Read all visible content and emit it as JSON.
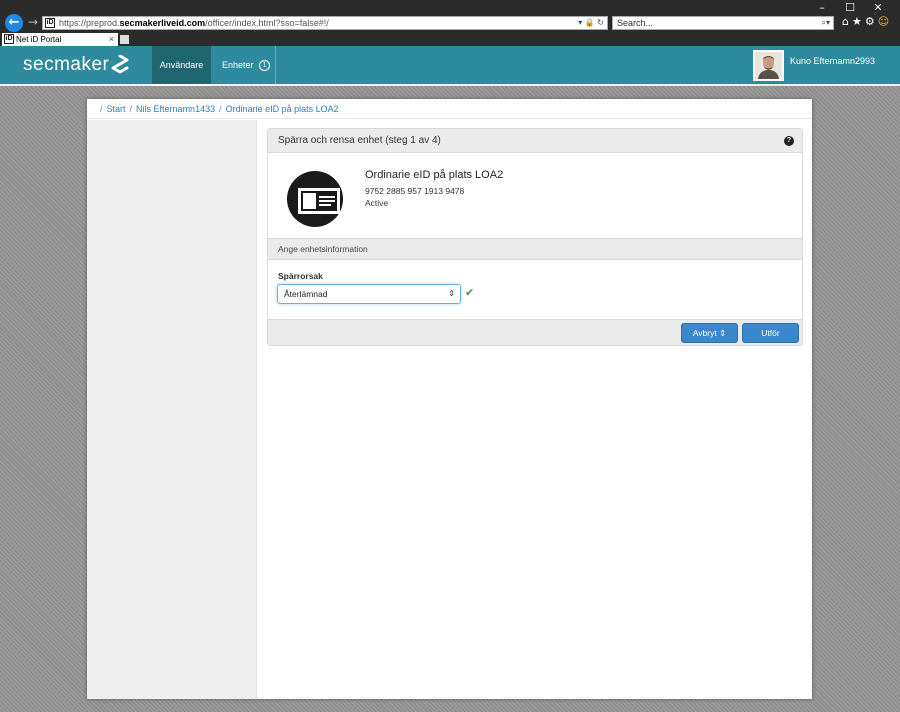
{
  "browser": {
    "url_prefix": "https://preprod.",
    "url_domain": "secmakerliveid.com",
    "url_path": "/officer/index.html?sso=false#!/",
    "address_icons": "▾ 🔒 ↻",
    "search_placeholder": "Search...",
    "search_icon": "⌕▾",
    "tab_title": "Net iD Portal",
    "tab_close": "×",
    "favicon_text": "iD",
    "window_controls": [
      "–",
      "☐",
      "✕"
    ]
  },
  "app": {
    "logo_text": "secmaker",
    "nav": {
      "users_label": "Användare",
      "units_label": "Enheter",
      "units_badge": "1"
    },
    "user_name": "Kuno Efternamn2993"
  },
  "breadcrumb": {
    "items": [
      "Start",
      "Nils Efternamn1433",
      "Ordinarie eID på plats LOA2"
    ]
  },
  "card": {
    "title": "Spärra och rensa enhet (steg 1 av 4)",
    "help_icon": "?",
    "device_name": "Ordinarie eID på plats LOA2",
    "device_number": "9752 2885 957 1913 9478",
    "device_status": "Active",
    "section_title": "Ange enhetsinformation",
    "field_label": "Spärrorsak",
    "select_value": "Återlämnad",
    "cancel_label": "Avbryt ⇕",
    "submit_label": "Utför"
  },
  "colors": {
    "header": "#2e8a9e",
    "nav_active": "#1f6670",
    "link": "#2a7fc0",
    "button": "#3a87cc",
    "check": "#3c9a3c"
  }
}
